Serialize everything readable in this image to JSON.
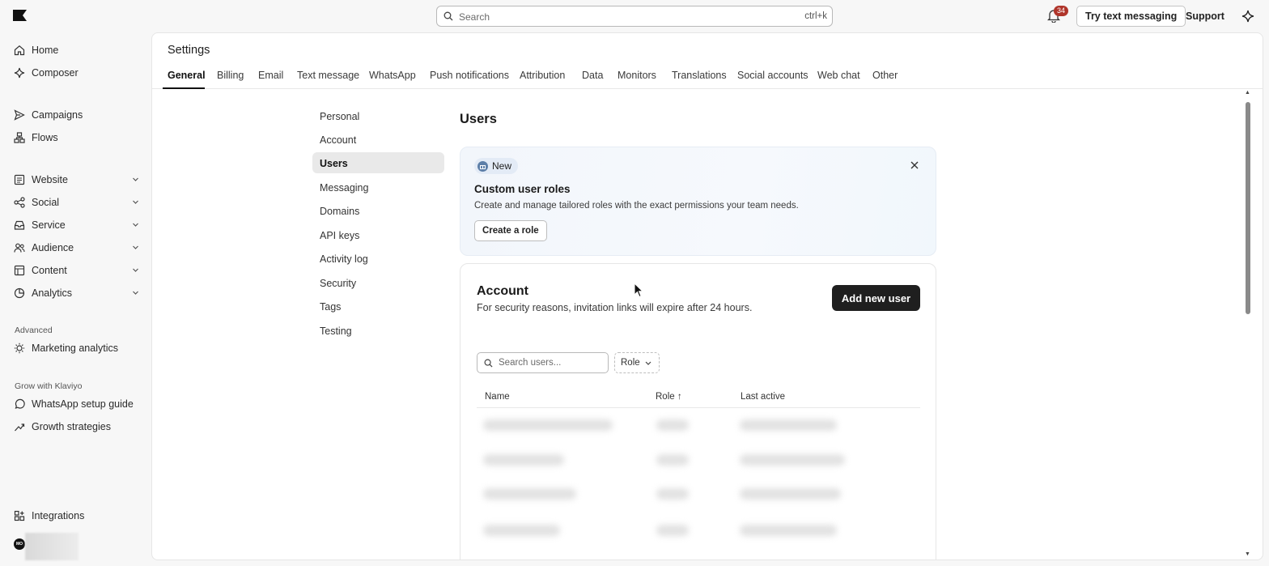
{
  "topbar": {
    "logo": "klaviyo-flag-logo",
    "search_placeholder": "Search",
    "search_shortcut": "ctrl+k",
    "notification_count": "34",
    "try_button": "Try text messaging",
    "support_link": "Support"
  },
  "sidebar": {
    "items": [
      {
        "label": "Home",
        "icon": "home-icon"
      },
      {
        "label": "Composer",
        "icon": "sparkle-icon"
      },
      {
        "label": "Campaigns",
        "icon": "send-icon"
      },
      {
        "label": "Flows",
        "icon": "flow-icon"
      },
      {
        "label": "Website",
        "icon": "website-icon"
      },
      {
        "label": "Social",
        "icon": "social-icon"
      },
      {
        "label": "Service",
        "icon": "inbox-icon"
      },
      {
        "label": "Audience",
        "icon": "audience-icon"
      },
      {
        "label": "Content",
        "icon": "content-icon"
      },
      {
        "label": "Analytics",
        "icon": "analytics-icon"
      }
    ],
    "advanced_label": "Advanced",
    "advanced_items": [
      {
        "label": "Marketing analytics",
        "icon": "bulb-icon"
      }
    ],
    "grow_label": "Grow with Klaviyo",
    "grow_items": [
      {
        "label": "WhatsApp setup guide",
        "icon": "whatsapp-icon"
      },
      {
        "label": "Growth strategies",
        "icon": "trend-icon"
      }
    ],
    "integrations": "Integrations",
    "avatar_initials": "MO"
  },
  "settings": {
    "title": "Settings",
    "tabs": [
      "General",
      "Billing",
      "Email",
      "Text message",
      "WhatsApp",
      "Push notifications",
      "Attribution",
      "Data",
      "Monitors",
      "Translations",
      "Social accounts",
      "Web chat",
      "Other"
    ],
    "active_tab": "General",
    "subnav": [
      "Personal",
      "Account",
      "Users",
      "Messaging",
      "Domains",
      "API keys",
      "Activity log",
      "Security",
      "Tags",
      "Testing"
    ],
    "active_subnav": "Users"
  },
  "users": {
    "title": "Users",
    "promo": {
      "badge": "New",
      "title": "Custom user roles",
      "description": "Create and manage tailored roles with the exact permissions your team needs.",
      "button": "Create a role"
    },
    "account": {
      "title": "Account",
      "description": "For security reasons, invitation links will expire after 24 hours.",
      "add_button": "Add new user",
      "search_placeholder": "Search users...",
      "role_filter": "Role",
      "columns": [
        "Name",
        "Role ↑",
        "Last active"
      ]
    }
  },
  "colors": {
    "accent_dark": "#1f1f1f",
    "badge_red": "#b0352b",
    "promo_bg": "#f3f7fc"
  }
}
